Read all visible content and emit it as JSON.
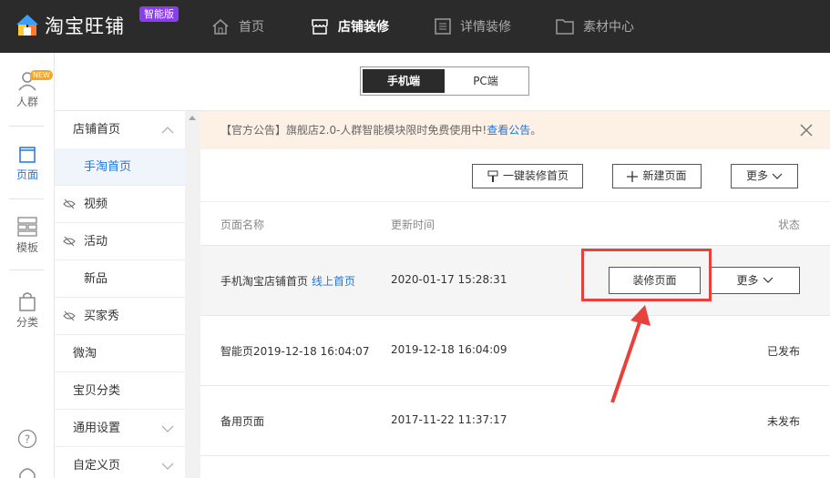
{
  "app": {
    "brand": "淘宝旺铺",
    "edition_badge": "智能版"
  },
  "topnav": [
    {
      "label": "首页",
      "icon": "home-icon",
      "active": false
    },
    {
      "label": "店铺装修",
      "icon": "shop-icon",
      "active": true
    },
    {
      "label": "详情装修",
      "icon": "detail-icon",
      "active": false
    },
    {
      "label": "素材中心",
      "icon": "folder-icon",
      "active": false
    }
  ],
  "leftbar": {
    "crowd": {
      "label": "人群",
      "new_tag": "NEW"
    },
    "page": {
      "label": "页面"
    },
    "template": {
      "label": "模板"
    },
    "category": {
      "label": "分类"
    },
    "help_icon": "question-icon",
    "service_icon": "headset-icon"
  },
  "mode_switch": {
    "mobile": "手机端",
    "pc": "PC端",
    "active": "mobile"
  },
  "subnav": {
    "store_home": "店铺首页",
    "mobile_home": "手淘首页",
    "video": "视频",
    "activity": "活动",
    "new_items": "新品",
    "buyer_show": "买家秀",
    "weitao": "微淘",
    "item_category": "宝贝分类",
    "general_settings": "通用设置",
    "custom_pages": "自定义页"
  },
  "notice": {
    "text": "【官方公告】旗舰店2.0-人群智能模块限时免费使用中!",
    "link": "查看公告",
    "suffix": "。"
  },
  "toolbar": {
    "one_click_label": "一键装修首页",
    "new_page_label": "新建页面",
    "more_label": "更多"
  },
  "table": {
    "headers": {
      "name": "页面名称",
      "updated": "更新时间",
      "status": "状态"
    },
    "rows": [
      {
        "name": "手机淘宝店铺首页",
        "link": "线上首页",
        "updated": "2020-01-17 15:28:31",
        "status": "",
        "decorate_label": "装修页面",
        "more_label": "更多"
      },
      {
        "name": "智能页2019-12-18 16:04:07",
        "link": "",
        "updated": "2019-12-18 16:04:09",
        "status": "已发布"
      },
      {
        "name": "备用页面",
        "link": "",
        "updated": "2017-11-22 11:37:17",
        "status": "未发布"
      }
    ]
  },
  "colors": {
    "topbar": "#2b2b2b",
    "accent": "#2277dd",
    "badge": "#8a3cf0",
    "annotation": "#e8413b",
    "notice_bg": "#fdf1e6"
  }
}
